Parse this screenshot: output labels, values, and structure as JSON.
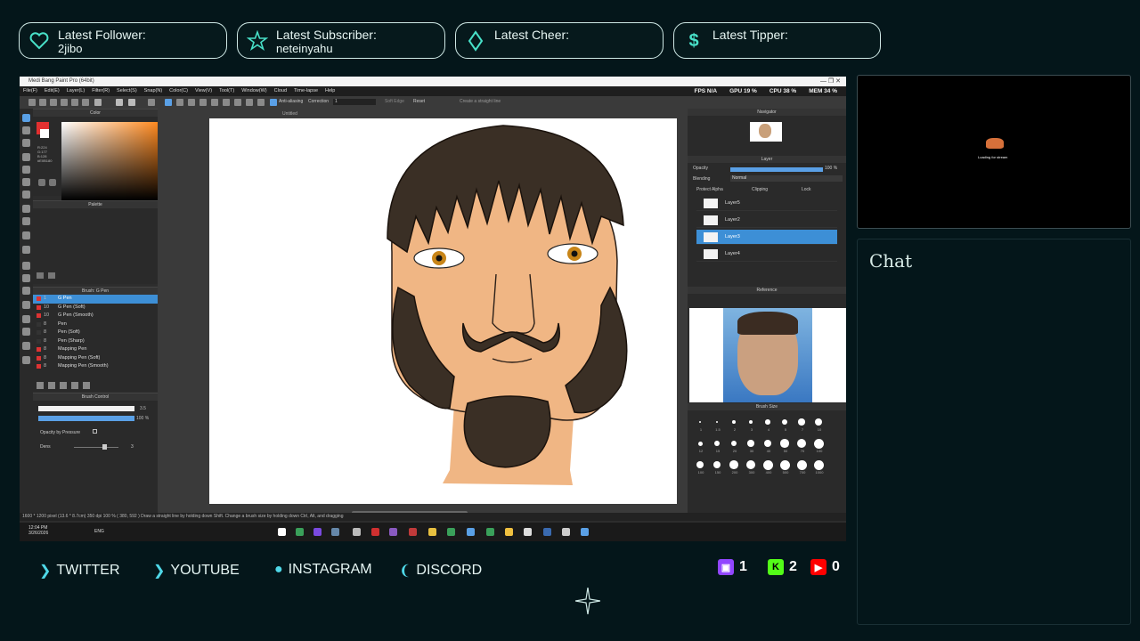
{
  "alerts": [
    {
      "title": "Latest Follower:",
      "value": "2jibo",
      "icon": "heart-icon"
    },
    {
      "title": "Latest Subscriber:",
      "value": "neteinyahu",
      "icon": "star-icon"
    },
    {
      "title": "Latest Cheer:",
      "value": "",
      "icon": "diamond-icon"
    },
    {
      "title": "Latest Tipper:",
      "value": "",
      "icon": "dollar-icon"
    }
  ],
  "app": {
    "title": "Medi Bang Paint Pro (64bit)",
    "window_controls": "— ❐ ✕",
    "menu": [
      "File(F)",
      "Edit(E)",
      "Layer(L)",
      "Filter(R)",
      "Select(S)",
      "Snap(N)",
      "Color(C)",
      "View(V)",
      "Tool(T)",
      "Window(W)",
      "Cloud",
      "Time-lapse",
      "Help"
    ],
    "stats": {
      "fps": "FPS N/A",
      "gpu": "GPU 19 %",
      "cpu": "CPU 38 %",
      "mem": "MEM 34 %"
    },
    "toolbar": {
      "antialias": "Anti-aliasing",
      "correction": "Correction",
      "correction_val": "1",
      "soft_edge": "Soft Edge",
      "reset": "Reset",
      "create_line": "Create a straight line"
    },
    "doc_name": "Untitled",
    "panels": {
      "color": "Color",
      "palette": "Palette",
      "brush": "Brush: G Pen",
      "brush_control": "Brush Control",
      "navigator": "Navigator",
      "layer": "Layer",
      "reference": "Reference",
      "brush_size": "Brush Size"
    },
    "color_values": {
      "r": "R:224",
      "g": "G:177",
      "b": "B:128",
      "hex": "#E0B180"
    },
    "brushes": [
      {
        "size": "1",
        "name": "G Pen",
        "selected": true
      },
      {
        "size": "10",
        "name": "G Pen (Soft)",
        "selected": false
      },
      {
        "size": "10",
        "name": "G Pen (Smooth)",
        "selected": false
      },
      {
        "size": "8",
        "name": "Pen",
        "selected": false
      },
      {
        "size": "8",
        "name": "Pen (Soft)",
        "selected": false
      },
      {
        "size": "8",
        "name": "Pen (Sharp)",
        "selected": false
      },
      {
        "size": "8",
        "name": "Mapping Pen",
        "selected": false
      },
      {
        "size": "8",
        "name": "Mapping Pen (Soft)",
        "selected": false
      },
      {
        "size": "8",
        "name": "Mapping Pen (Smooth)",
        "selected": false
      }
    ],
    "brush_control": {
      "size_val": "3.5",
      "opacity_val": "100 %",
      "pressure_label": "Opacity by Pressure",
      "dens_label": "Dens",
      "dens_val": "3"
    },
    "layer_panel": {
      "opacity_label": "Opacity",
      "opacity_val": "100 %",
      "blending_label": "Blending",
      "blending_val": "Normal",
      "protect_alpha": "Protect Alpha",
      "clipping": "Clipping",
      "lock": "Lock"
    },
    "layers": [
      {
        "name": "Layer5",
        "selected": false
      },
      {
        "name": "Layer2",
        "selected": false
      },
      {
        "name": "Layer3",
        "selected": true
      },
      {
        "name": "Layer4",
        "selected": false
      }
    ],
    "brush_sizes": [
      "1",
      "1.5",
      "2",
      "3",
      "4",
      "5",
      "7",
      "10",
      "12",
      "15",
      "20",
      "30",
      "40",
      "50",
      "70",
      "100",
      "100",
      "150",
      "200",
      "300",
      "400",
      "500",
      "700",
      "1000"
    ],
    "status": "1600 * 1200 pixel   (13.6 * 8.7cm)   350 dpi   100 %   ( 380, 592 )   Draw a straight line by holding down Shift. Change a brush size by holding down Ctrl, Alt, and dragging"
  },
  "taskbar": {
    "time": "12:04 PM",
    "date": "3/26/2026",
    "lang": "ENG"
  },
  "camera_label": "Loading for stream",
  "chat_title": "Chat",
  "socials": [
    {
      "glyph": "❯",
      "label": "TWITTER"
    },
    {
      "glyph": "❯",
      "label": "YOUTUBE"
    },
    {
      "glyph": "●",
      "label": "INSTAGRAM"
    },
    {
      "glyph": "❨",
      "label": "DISCORD"
    }
  ],
  "viewer_stats": [
    {
      "platform": "twitch",
      "count": "1",
      "color": "#9146ff"
    },
    {
      "platform": "kick",
      "count": "2",
      "color": "#53fc18"
    },
    {
      "platform": "youtube",
      "count": "0",
      "color": "#ff0000"
    }
  ]
}
